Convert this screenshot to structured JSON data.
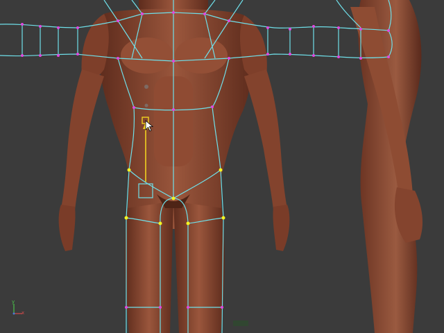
{
  "axis": {
    "x_label": "x",
    "y_label": "y"
  },
  "colors": {
    "background": "#3b3b3b",
    "skin": "#8a4a33",
    "skin_dark": "#5a2a1c",
    "edge": "#6fe0ea",
    "vertex": "#e049e0",
    "selected_vertex": "#f5f520",
    "manipulator": "#f0d320",
    "axis_x": "#d24a4a",
    "axis_y": "#4ac24a"
  },
  "icons": {
    "cursor": "arrow-cursor-icon",
    "move_handle": "move-manipulator-icon"
  }
}
